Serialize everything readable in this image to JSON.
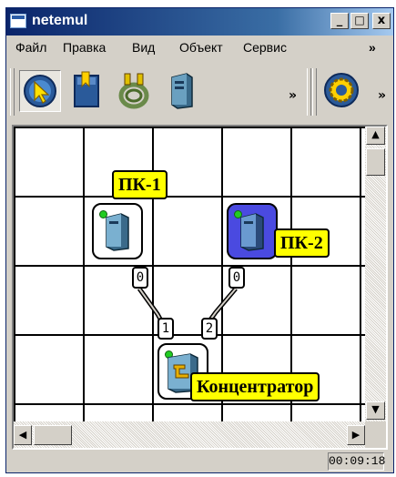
{
  "window": {
    "title": "netemul",
    "controls": {
      "minimize": "_",
      "maximize": "□",
      "close": "x"
    }
  },
  "menu": {
    "items": [
      "Файл",
      "Правка",
      "Вид",
      "Объект",
      "Сервис"
    ],
    "overflow": "»"
  },
  "toolbar": {
    "tools": [
      "cursor-icon",
      "note-icon",
      "cable-icon",
      "computer-icon"
    ],
    "overflow": "»",
    "settings": "gear-icon",
    "overflow2": "»"
  },
  "canvas": {
    "devices": [
      {
        "label": "ПК-1",
        "type": "computer",
        "selected": false,
        "port": "0"
      },
      {
        "label": "ПК-2",
        "type": "computer",
        "selected": true,
        "port": "0"
      },
      {
        "label": "Концентратор",
        "type": "hub",
        "selected": false,
        "ports": [
          "1",
          "2"
        ]
      }
    ]
  },
  "status": {
    "time": "00:09:18"
  },
  "colors": {
    "title_bar": "#0a246a",
    "label_bg": "#ffff00",
    "selected_device": "#4a4ae0",
    "link_led": "#22cc22"
  }
}
